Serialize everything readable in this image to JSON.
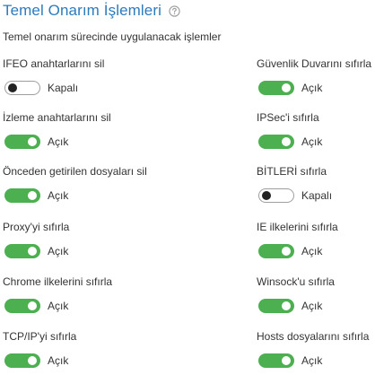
{
  "section": {
    "title": "Temel Onarım İşlemleri",
    "help_icon": "question-circle-icon",
    "subtitle": "Temel onarım sürecinde uygulanacak işlemler"
  },
  "state_labels": {
    "on": "Açık",
    "off": "Kapalı"
  },
  "colors": {
    "title": "#2b7bbf",
    "toggle_on": "#4caf50",
    "toggle_off_border": "#9e9e9e"
  },
  "left_items": [
    {
      "label": "IFEO anahtarlarını sil",
      "enabled": false,
      "state": "Kapalı"
    },
    {
      "label": "İzleme anahtarlarını sil",
      "enabled": true,
      "state": "Açık"
    },
    {
      "label": "Önceden getirilen dosyaları sil",
      "enabled": true,
      "state": "Açık"
    },
    {
      "label": "Proxy'yi sıfırla",
      "enabled": true,
      "state": "Açık"
    },
    {
      "label": "Chrome ilkelerini sıfırla",
      "enabled": true,
      "state": "Açık"
    },
    {
      "label": "TCP/IP'yi sıfırla",
      "enabled": true,
      "state": "Açık"
    }
  ],
  "right_items": [
    {
      "label": "Güvenlik Duvarını sıfırla",
      "enabled": true,
      "state": "Açık"
    },
    {
      "label": "IPSec'i sıfırla",
      "enabled": true,
      "state": "Açık"
    },
    {
      "label": "BİTLERİ sıfırla",
      "enabled": false,
      "state": "Kapalı"
    },
    {
      "label": "IE ilkelerini sıfırla",
      "enabled": true,
      "state": "Açık"
    },
    {
      "label": "Winsock'u sıfırla",
      "enabled": true,
      "state": "Açık"
    },
    {
      "label": "Hosts dosyalarını sıfırla",
      "enabled": true,
      "state": "Açık"
    }
  ]
}
